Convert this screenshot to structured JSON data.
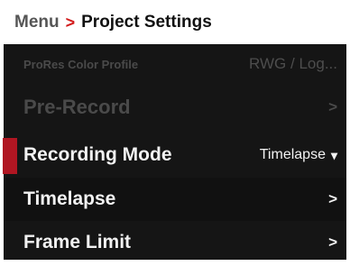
{
  "header": {
    "breadcrumb_root": "Menu",
    "separator": ">",
    "title": "Project Settings"
  },
  "colors": {
    "panel_background": "#151515",
    "accent_selected": "#b01622",
    "breadcrumb_separator": "#d21a1a",
    "disabled_text": "#4a4a4a"
  },
  "menu": {
    "items": [
      {
        "label": "ProRes Color Profile",
        "value": "RWG / Log...",
        "state": "disabled"
      },
      {
        "label": "Pre-Record",
        "chevron": ">",
        "state": "disabled"
      },
      {
        "label": "Recording Mode",
        "value": "Timelapse",
        "chevron": "▾",
        "state": "enabled"
      },
      {
        "label": "Timelapse",
        "chevron": ">",
        "state": "selected"
      },
      {
        "label": "Frame Limit",
        "chevron": ">",
        "state": "enabled"
      }
    ]
  }
}
